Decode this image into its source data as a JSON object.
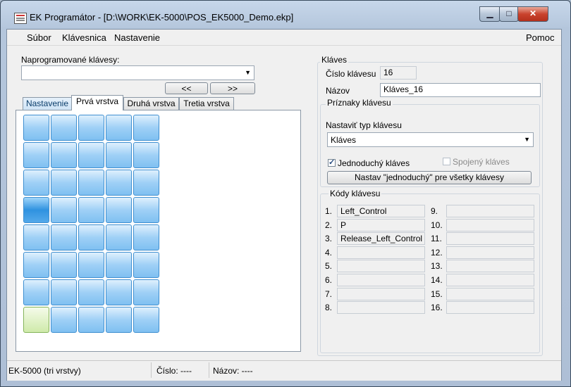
{
  "window": {
    "title": "EK Programátor -  [D:\\WORK\\EK-5000\\POS_EK5000_Demo.ekp]"
  },
  "menu": {
    "items": [
      "Súbor",
      "Klávesnica",
      "Nastavenie"
    ],
    "help": "Pomoc"
  },
  "left": {
    "programmed_label": "Naprogramované klávesy:",
    "programmed_value": "",
    "prev_label": "<<",
    "next_label": ">>",
    "tabs": [
      "Nastavenie",
      "Prvá vrstva",
      "Druhá vrstva",
      "Tretia vrstva"
    ],
    "active_tab": 1,
    "grid": {
      "rows": 8,
      "cols": 5,
      "selected": [
        3,
        0
      ],
      "highlighted": [
        7,
        0
      ]
    }
  },
  "key": {
    "group_title": "Kláves",
    "number_label": "Číslo klávesu",
    "number_value": "16",
    "name_label": "Názov",
    "name_value": "Kláves_16"
  },
  "flags": {
    "group_title": "Príznaky klávesu",
    "type_label": "Nastaviť typ klávesu",
    "type_value": "Kláves",
    "simple_label": "Jednoduchý kláves",
    "simple_checked": true,
    "joined_label": "Spojený kláves",
    "joined_checked": false,
    "set_all_label": "Nastav \"jednoduchý\" pre všetky klávesy"
  },
  "codes": {
    "group_title": "Kódy klávesu",
    "left": [
      {
        "n": "1.",
        "v": "Left_Control"
      },
      {
        "n": "2.",
        "v": "P"
      },
      {
        "n": "3.",
        "v": "Release_Left_Control"
      },
      {
        "n": "4.",
        "v": ""
      },
      {
        "n": "5.",
        "v": ""
      },
      {
        "n": "6.",
        "v": ""
      },
      {
        "n": "7.",
        "v": ""
      },
      {
        "n": "8.",
        "v": ""
      }
    ],
    "right": [
      {
        "n": "9.",
        "v": ""
      },
      {
        "n": "10.",
        "v": ""
      },
      {
        "n": "11.",
        "v": ""
      },
      {
        "n": "12.",
        "v": ""
      },
      {
        "n": "13.",
        "v": ""
      },
      {
        "n": "14.",
        "v": ""
      },
      {
        "n": "15.",
        "v": ""
      },
      {
        "n": "16.",
        "v": ""
      }
    ]
  },
  "status": {
    "device": "EK-5000 (tri vrstvy)",
    "number": "Číslo: ----",
    "name": "Názov: ----"
  }
}
